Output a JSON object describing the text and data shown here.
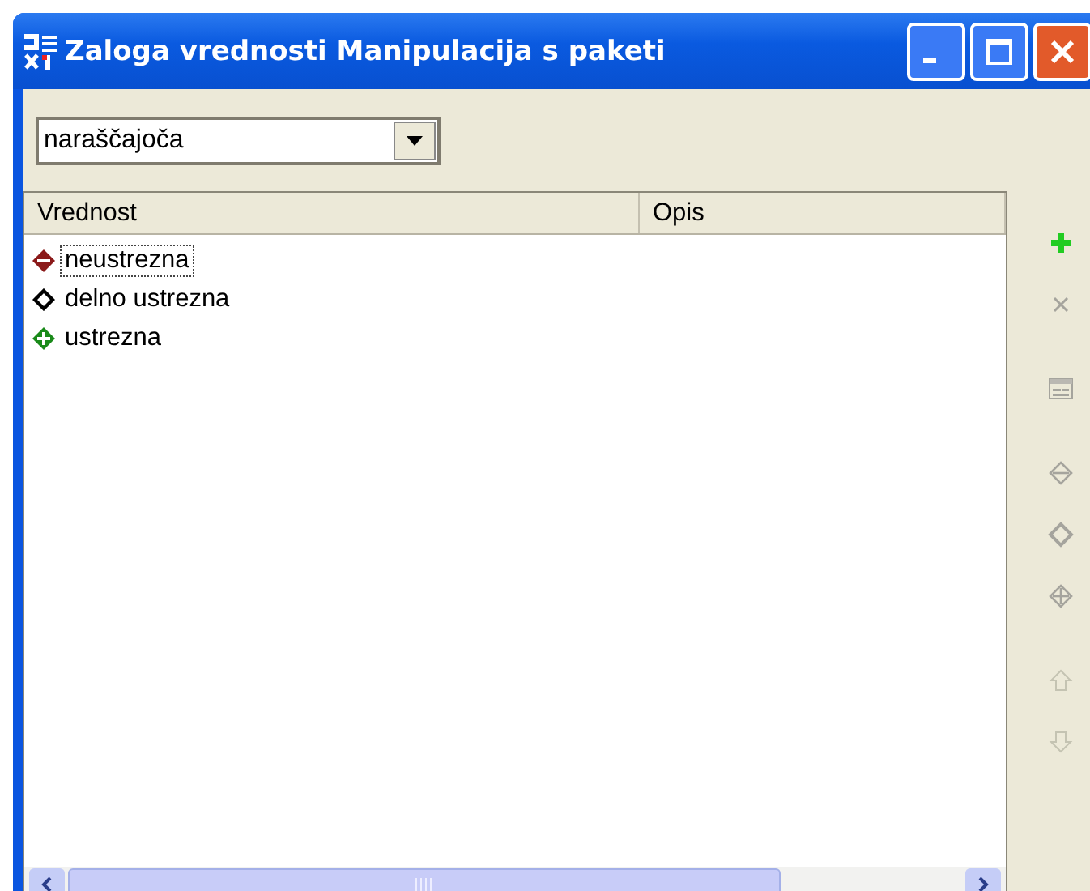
{
  "window": {
    "title": "Zaloga vrednosti Manipulacija s paketi"
  },
  "sort_dropdown": {
    "value": "naraščajoča"
  },
  "table": {
    "columns": [
      "Vrednost",
      "Opis"
    ],
    "rows": [
      {
        "value": "neustrezna",
        "kind": "minus",
        "selected": true
      },
      {
        "value": "delno ustrezna",
        "kind": "empty",
        "selected": false
      },
      {
        "value": "ustrezna",
        "kind": "plus",
        "selected": false
      }
    ]
  },
  "toolbar": [
    {
      "kind": "add",
      "disabled": false
    },
    {
      "kind": "delete",
      "disabled": true
    },
    {
      "kind": "form",
      "disabled": true
    },
    {
      "kind": "minus",
      "disabled": true
    },
    {
      "kind": "empty",
      "disabled": true
    },
    {
      "kind": "plus",
      "disabled": true
    },
    {
      "kind": "up",
      "disabled": true
    },
    {
      "kind": "down",
      "disabled": true
    }
  ]
}
